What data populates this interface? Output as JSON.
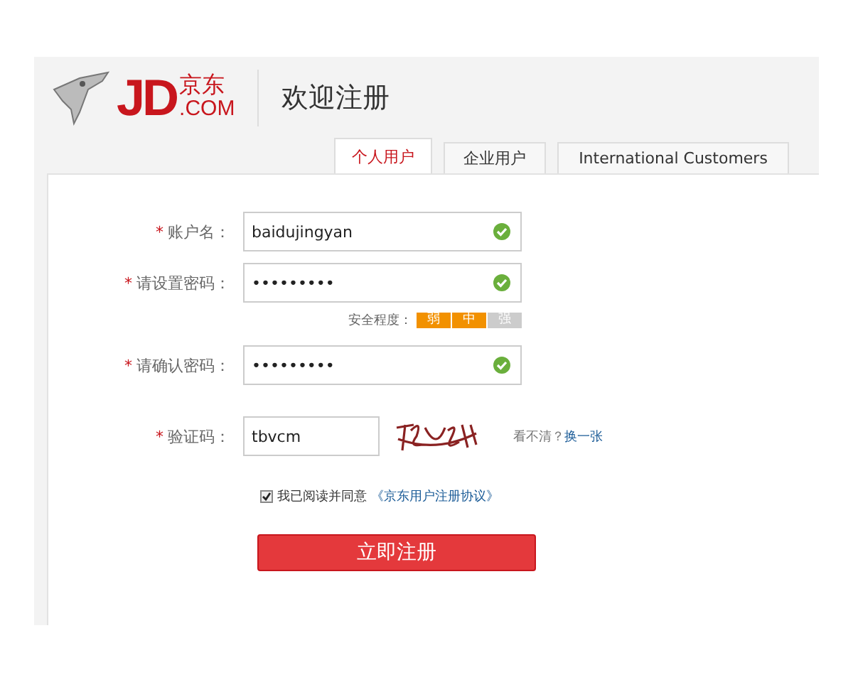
{
  "header": {
    "logo": {
      "mark": "JD",
      "chinese": "京东",
      "domain": ".COM"
    },
    "title": "欢迎注册"
  },
  "tabs": [
    {
      "label": "个人用户",
      "selected": true
    },
    {
      "label": "企业用户",
      "selected": false
    },
    {
      "label": "International Customers",
      "selected": false
    }
  ],
  "form": {
    "fields": [
      {
        "kind": "input",
        "label": "账户名：",
        "required_mark": "*",
        "value": "baidujingyan",
        "valid": true
      },
      {
        "kind": "input",
        "label": "请设置密码：",
        "required_mark": "*",
        "value": "•••••••••",
        "valid": true
      },
      {
        "kind": "strength",
        "label": "安全程度：",
        "levels": [
          {
            "label": "弱",
            "on": true
          },
          {
            "label": "中",
            "on": true
          },
          {
            "label": "强",
            "on": false
          }
        ]
      },
      {
        "kind": "input",
        "label": "请确认密码：",
        "required_mark": "*",
        "value": "•••••••••",
        "valid": true
      },
      {
        "kind": "captcha",
        "label": "验证码：",
        "required_mark": "*",
        "value": "tbvcm",
        "hint": "看不清？",
        "refresh_link": "换一张"
      }
    ],
    "agreement": {
      "checked": true,
      "text": "我已阅读并同意",
      "link": "《京东用户注册协议》"
    },
    "submit": "立即注册"
  }
}
